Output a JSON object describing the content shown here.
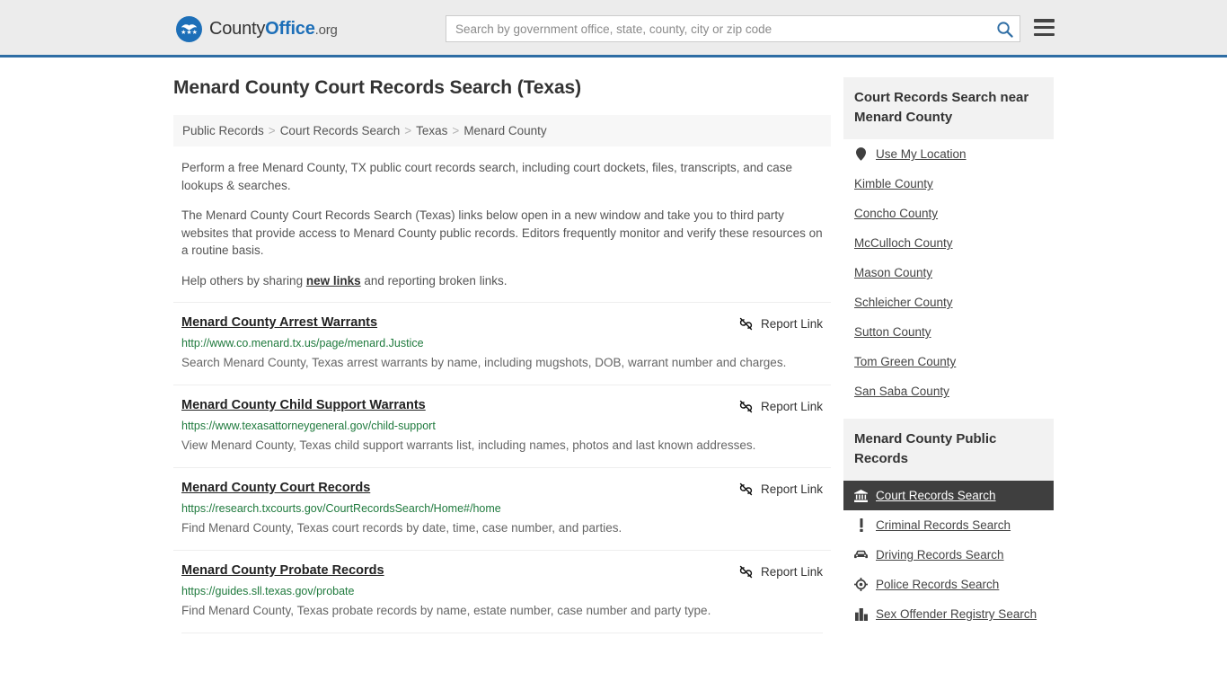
{
  "header": {
    "brand": {
      "part1": "County",
      "part2": "Office",
      "tld": ".org",
      "stars": "★★★"
    },
    "search": {
      "placeholder": "Search by government office, state, county, city or zip code",
      "value": ""
    },
    "search_icon": "search-icon",
    "menu_icon": "hamburger-menu-icon"
  },
  "page": {
    "title": "Menard County Court Records Search (Texas)"
  },
  "breadcrumb": {
    "items": [
      "Public Records",
      "Court Records Search",
      "Texas",
      "Menard County"
    ],
    "separator": ">"
  },
  "intro": {
    "p1": "Perform a free Menard County, TX public court records search, including court dockets, files, transcripts, and case lookups & searches.",
    "p2": "The Menard County Court Records Search (Texas) links below open in a new window and take you to third party websites that provide access to Menard County public records. Editors frequently monitor and verify these resources on a routine basis.",
    "p3_before": "Help others by sharing ",
    "p3_link": "new links",
    "p3_after": " and reporting broken links."
  },
  "results": {
    "report_label": "Report Link",
    "report_icon": "broken-link-icon",
    "items": [
      {
        "title": "Menard County Arrest Warrants",
        "url": "http://www.co.menard.tx.us/page/menard.Justice",
        "desc": "Search Menard County, Texas arrest warrants by name, including mugshots, DOB, warrant number and charges."
      },
      {
        "title": "Menard County Child Support Warrants",
        "url": "https://www.texasattorneygeneral.gov/child-support",
        "desc": "View Menard County, Texas child support warrants list, including names, photos and last known addresses."
      },
      {
        "title": "Menard County Court Records",
        "url": "https://research.txcourts.gov/CourtRecordsSearch/Home#/home",
        "desc": "Find Menard County, Texas court records by date, time, case number, and parties."
      },
      {
        "title": "Menard County Probate Records",
        "url": "https://guides.sll.texas.gov/probate",
        "desc": "Find Menard County, Texas probate records by name, estate number, case number and party type."
      }
    ]
  },
  "sidebar": {
    "nearby": {
      "heading": "Court Records Search near Menard County",
      "items": [
        {
          "label": "Use My Location",
          "icon": "map-pin-icon"
        },
        {
          "label": "Kimble County",
          "icon": ""
        },
        {
          "label": "Concho County",
          "icon": ""
        },
        {
          "label": "McCulloch County",
          "icon": ""
        },
        {
          "label": "Mason County",
          "icon": ""
        },
        {
          "label": "Schleicher County",
          "icon": ""
        },
        {
          "label": "Sutton County",
          "icon": ""
        },
        {
          "label": "Tom Green County",
          "icon": ""
        },
        {
          "label": "San Saba County",
          "icon": ""
        }
      ]
    },
    "public_records": {
      "heading": "Menard County Public Records",
      "items": [
        {
          "label": "Court Records Search",
          "icon": "courthouse-icon",
          "active": true
        },
        {
          "label": "Criminal Records Search",
          "icon": "exclamation-icon",
          "active": false
        },
        {
          "label": "Driving Records Search",
          "icon": "car-icon",
          "active": false
        },
        {
          "label": "Police Records Search",
          "icon": "police-badge-icon",
          "active": false
        },
        {
          "label": "Sex Offender Registry Search",
          "icon": "buildings-icon",
          "active": false
        }
      ]
    }
  },
  "colors": {
    "accent_blue": "#2e6da4",
    "brand_blue": "#1d6fb8",
    "header_bg": "#ececec",
    "url_green": "#1f7a3d",
    "active_bg": "#3f3f3f"
  }
}
